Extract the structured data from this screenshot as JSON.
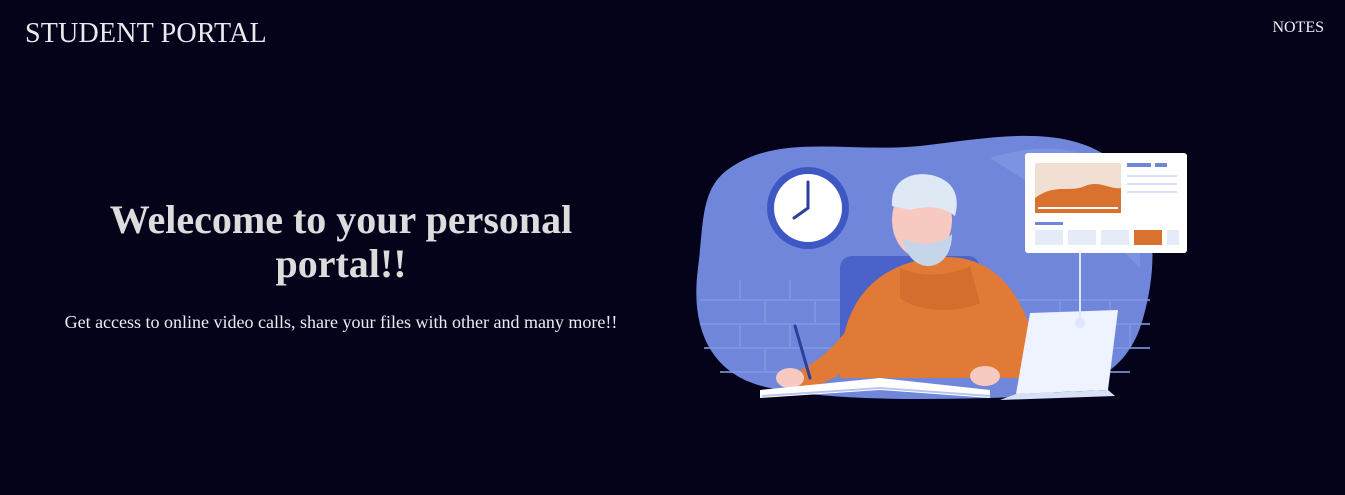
{
  "header": {
    "brand": "STUDENT PORTAL",
    "nav": [
      {
        "label": "NOTES"
      }
    ]
  },
  "hero": {
    "title": "Welecome to your personal portal!!",
    "subtitle": "Get access to online video calls, share your files with other and many more!!"
  },
  "illustration": {
    "subject": "person-studying-with-laptop",
    "colors": {
      "blob": "#6f86db",
      "shirt": "#e07a36",
      "screen": "#ffffff",
      "accent": "#d9722f"
    }
  },
  "colors": {
    "background": "#05031a",
    "text": "#e9e9ef",
    "title": "#dcdcdc"
  }
}
